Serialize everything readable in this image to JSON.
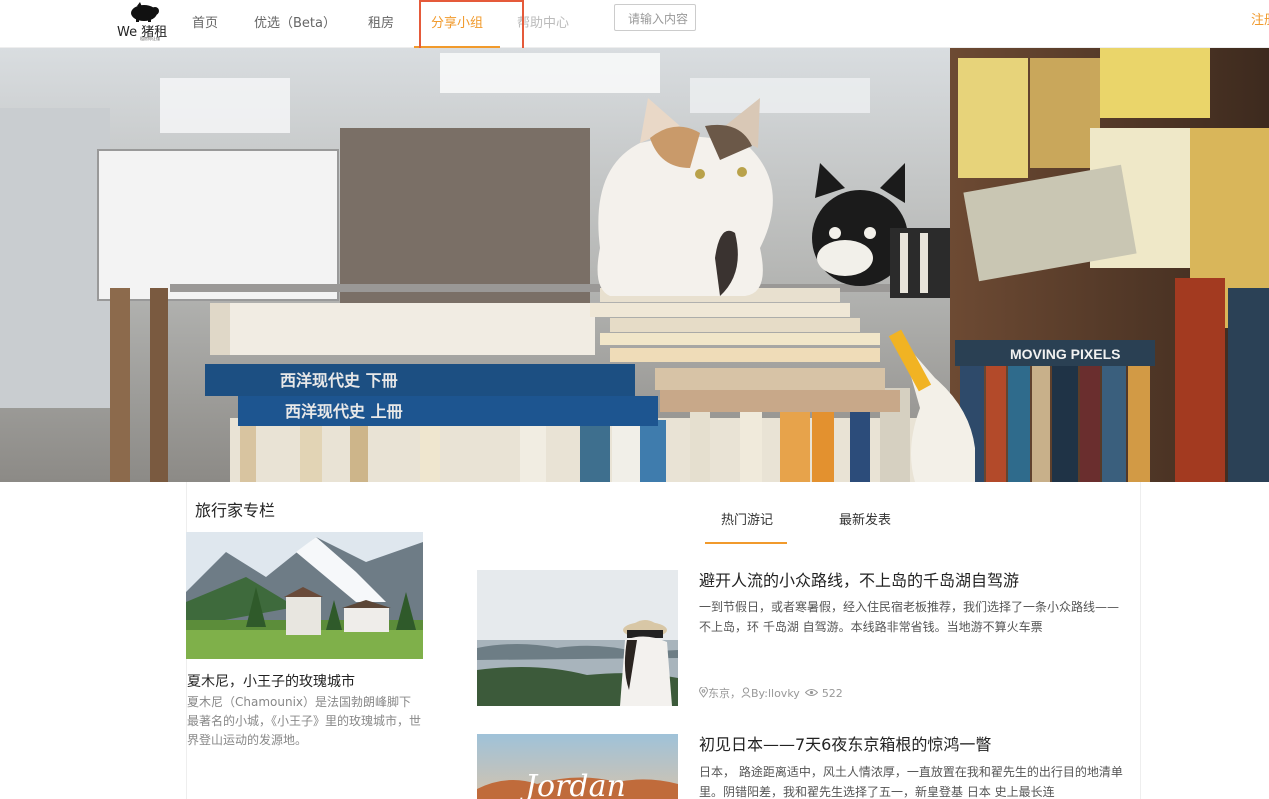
{
  "nav": {
    "logo_text": "We 猪租",
    "logo_subtext": "租房你让懂",
    "items": [
      {
        "label": "首页"
      },
      {
        "label": "优选（Beta）"
      },
      {
        "label": "租房"
      },
      {
        "label": "分享小组"
      },
      {
        "label": "帮助中心"
      }
    ],
    "active_index": 3,
    "search_placeholder": "请输入内容",
    "register": "注册"
  },
  "colors": {
    "accent": "#f19a2c",
    "annotation": "#e55a3a"
  },
  "hero": {
    "image": "cat-in-bookstore",
    "book_spine_1": "西洋现代史 下冊",
    "book_spine_2": "西洋现代史 上冊",
    "book_spine_3": "MOVING PIXELS"
  },
  "column": {
    "title": "旅行家专栏",
    "feature": {
      "image": "chamonix-mountain-village",
      "title": "夏木尼，小王子的玫瑰城市",
      "desc": "夏木尼（Chamounix）是法国勃朗峰脚下最著名的小城，《小王子》里的玫瑰城市，世界登山运动的发源地。"
    }
  },
  "tabs": [
    {
      "label": "热门游记"
    },
    {
      "label": "最新发表"
    }
  ],
  "articles": [
    {
      "image": "woman-with-hat-by-lake",
      "title": "避开人流的小众路线，不上岛的千岛湖自驾游",
      "desc": "一到节假日，或者寒暑假，经入住民宿老板推荐，我们选择了一条小众路线——不上岛，环 千岛湖 自驾游。本线路非常省钱。当地游不算火车票",
      "location": "东京",
      "author": "By:llovky",
      "views": "522"
    },
    {
      "image": "jordan-desert",
      "title": "初见日本——7天6夜东京箱根的惊鸿一瞥",
      "desc": "日本， 路途距离适中，风土人情浓厚，一直放置在我和翟先生的出行目的地清单里。阴错阳差，我和翟先生选择了五一，新皇登基 日本 史上最长连",
      "image_text": "Jordan"
    }
  ]
}
